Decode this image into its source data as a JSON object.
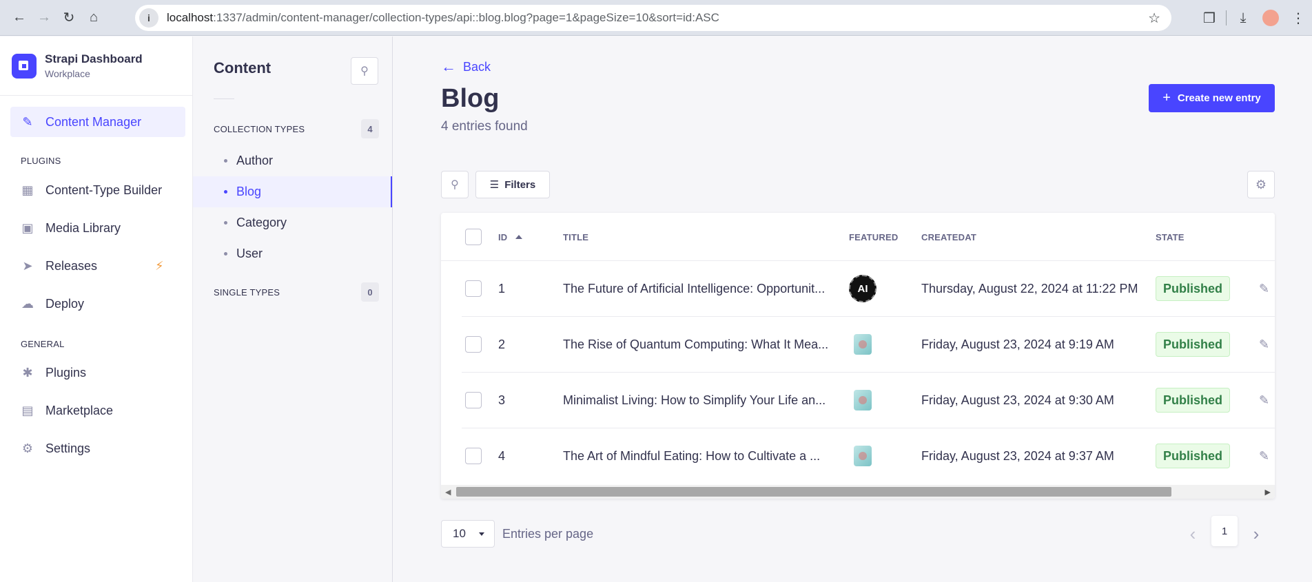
{
  "browser": {
    "url_host": "localhost",
    "url_path": ":1337/admin/content-manager/collection-types/api::blog.blog?page=1&pageSize=10&sort=id:ASC"
  },
  "brand": {
    "title": "Strapi Dashboard",
    "subtitle": "Workplace"
  },
  "main_nav": {
    "content_manager": "Content Manager",
    "plugins_heading": "PLUGINS",
    "plugins": [
      "Content-Type Builder",
      "Media Library",
      "Releases",
      "Deploy"
    ],
    "general_heading": "GENERAL",
    "general": [
      "Plugins",
      "Marketplace",
      "Settings"
    ]
  },
  "sub_nav": {
    "title": "Content",
    "collection_heading": "COLLECTION TYPES",
    "collection_count": "4",
    "collection_items": [
      "Author",
      "Blog",
      "Category",
      "User"
    ],
    "active_item": "Blog",
    "single_heading": "SINGLE TYPES",
    "single_count": "0"
  },
  "header": {
    "back": "Back",
    "title": "Blog",
    "subtitle": "4 entries found",
    "create": "Create new entry"
  },
  "toolbar": {
    "filters": "Filters"
  },
  "table": {
    "columns": {
      "id": "ID",
      "title": "TITLE",
      "featured": "FEATURED",
      "createdAt": "CREATEDAT",
      "state": "STATE"
    },
    "rows": [
      {
        "id": "1",
        "title": "The Future of Artificial Intelligence: Opportunit...",
        "featured_text": "AI",
        "createdAt": "Thursday, August 22, 2024 at 11:22 PM",
        "state": "Published"
      },
      {
        "id": "2",
        "title": "The Rise of Quantum Computing: What It Mea...",
        "createdAt": "Friday, August 23, 2024 at 9:19 AM",
        "state": "Published"
      },
      {
        "id": "3",
        "title": "Minimalist Living: How to Simplify Your Life an...",
        "createdAt": "Friday, August 23, 2024 at 9:30 AM",
        "state": "Published"
      },
      {
        "id": "4",
        "title": "The Art of Mindful Eating: How to Cultivate a ...",
        "createdAt": "Friday, August 23, 2024 at 9:37 AM",
        "state": "Published"
      }
    ]
  },
  "pagination": {
    "page_size": "10",
    "per_page_label": "Entries per page",
    "current_page": "1"
  },
  "colors": {
    "primary": "#4945ff",
    "published_text": "#328048",
    "published_bg": "#eafbe7",
    "bolt": "#f29d41"
  }
}
